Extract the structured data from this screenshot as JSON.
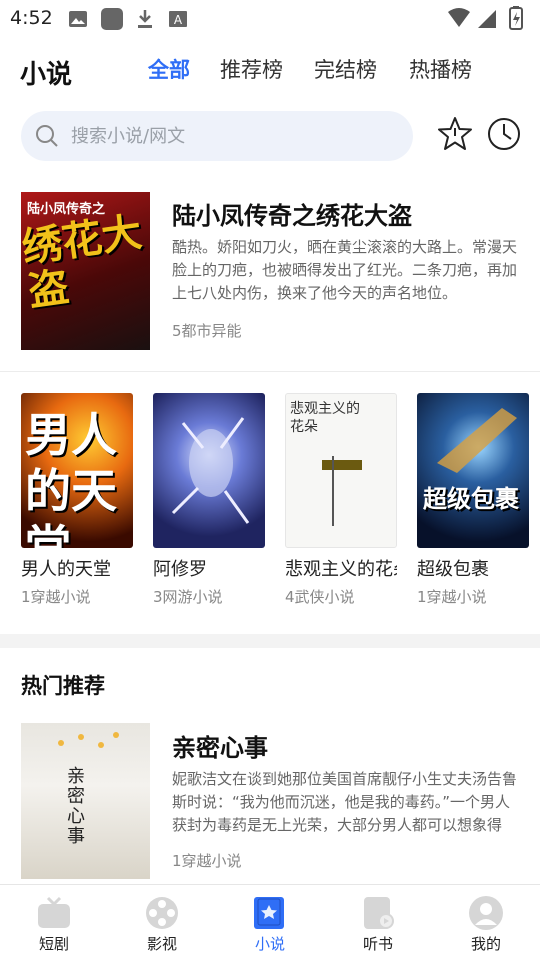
{
  "status_bar": {
    "time": "4:52",
    "icons": [
      "image-icon",
      "app-icon",
      "download-icon",
      "font-icon",
      "wifi-icon",
      "signal-icon",
      "battery-icon"
    ]
  },
  "header": {
    "title": "小说",
    "tabs": [
      {
        "label": "全部",
        "active": true
      },
      {
        "label": "推荐榜",
        "active": false
      },
      {
        "label": "完结榜",
        "active": false
      },
      {
        "label": "热播榜",
        "active": false
      }
    ]
  },
  "search": {
    "placeholder": "搜索小说/网文"
  },
  "header_icons": [
    "star-icon",
    "history-clock-icon"
  ],
  "featured": {
    "cover_text": "陆小凤传奇之",
    "cover_big_text": "绣花大盗",
    "title": "陆小凤传奇之绣花大盗",
    "description": "酷热。娇阳如刀火，晒在黄尘滚滚的大路上。常漫天脸上的刀疤，也被晒得发出了红光。二条刀疤，再加上七八处内伤，换来了他今天的声名地位。",
    "meta": "5都市异能"
  },
  "book_row": [
    {
      "title": "男人的天堂",
      "meta": "1穿越小说",
      "cover_text": "男人的天堂"
    },
    {
      "title": "阿修罗",
      "meta": "3网游小说",
      "cover_text": ""
    },
    {
      "title": "悲观主义的花朵",
      "meta": "4武侠小说",
      "cover_text": "悲观主义的花朵"
    },
    {
      "title": "超级包裹",
      "meta": "1穿越小说",
      "cover_text": "超级包裹"
    }
  ],
  "hot_section": {
    "title": "热门推荐",
    "item": {
      "cover_text": "亲密心事",
      "title": "亲密心事",
      "description": "妮歌洁文在谈到她那位美国首席靓仔小生丈夫汤告鲁斯时说：“我为他而沉迷，他是我的毒药。”一个男人获封为毒药是无上光荣，大部分男人都可以想象得到。",
      "meta": "1穿越小说"
    }
  },
  "bottom_nav": [
    {
      "label": "短剧",
      "icon": "tv-icon",
      "active": false
    },
    {
      "label": "影视",
      "icon": "film-reel-icon",
      "active": false
    },
    {
      "label": "小说",
      "icon": "book-icon",
      "active": true
    },
    {
      "label": "听书",
      "icon": "audiobook-icon",
      "active": false
    },
    {
      "label": "我的",
      "icon": "profile-icon",
      "active": false
    }
  ],
  "colors": {
    "accent": "#2f6ef6",
    "search_bg": "#eef2fa",
    "muted_text": "#888888"
  }
}
